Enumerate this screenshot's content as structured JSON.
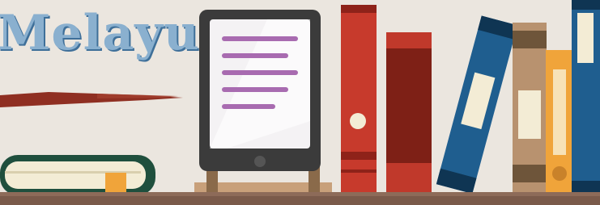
{
  "banner": {
    "title_fragment": "Melayu"
  }
}
